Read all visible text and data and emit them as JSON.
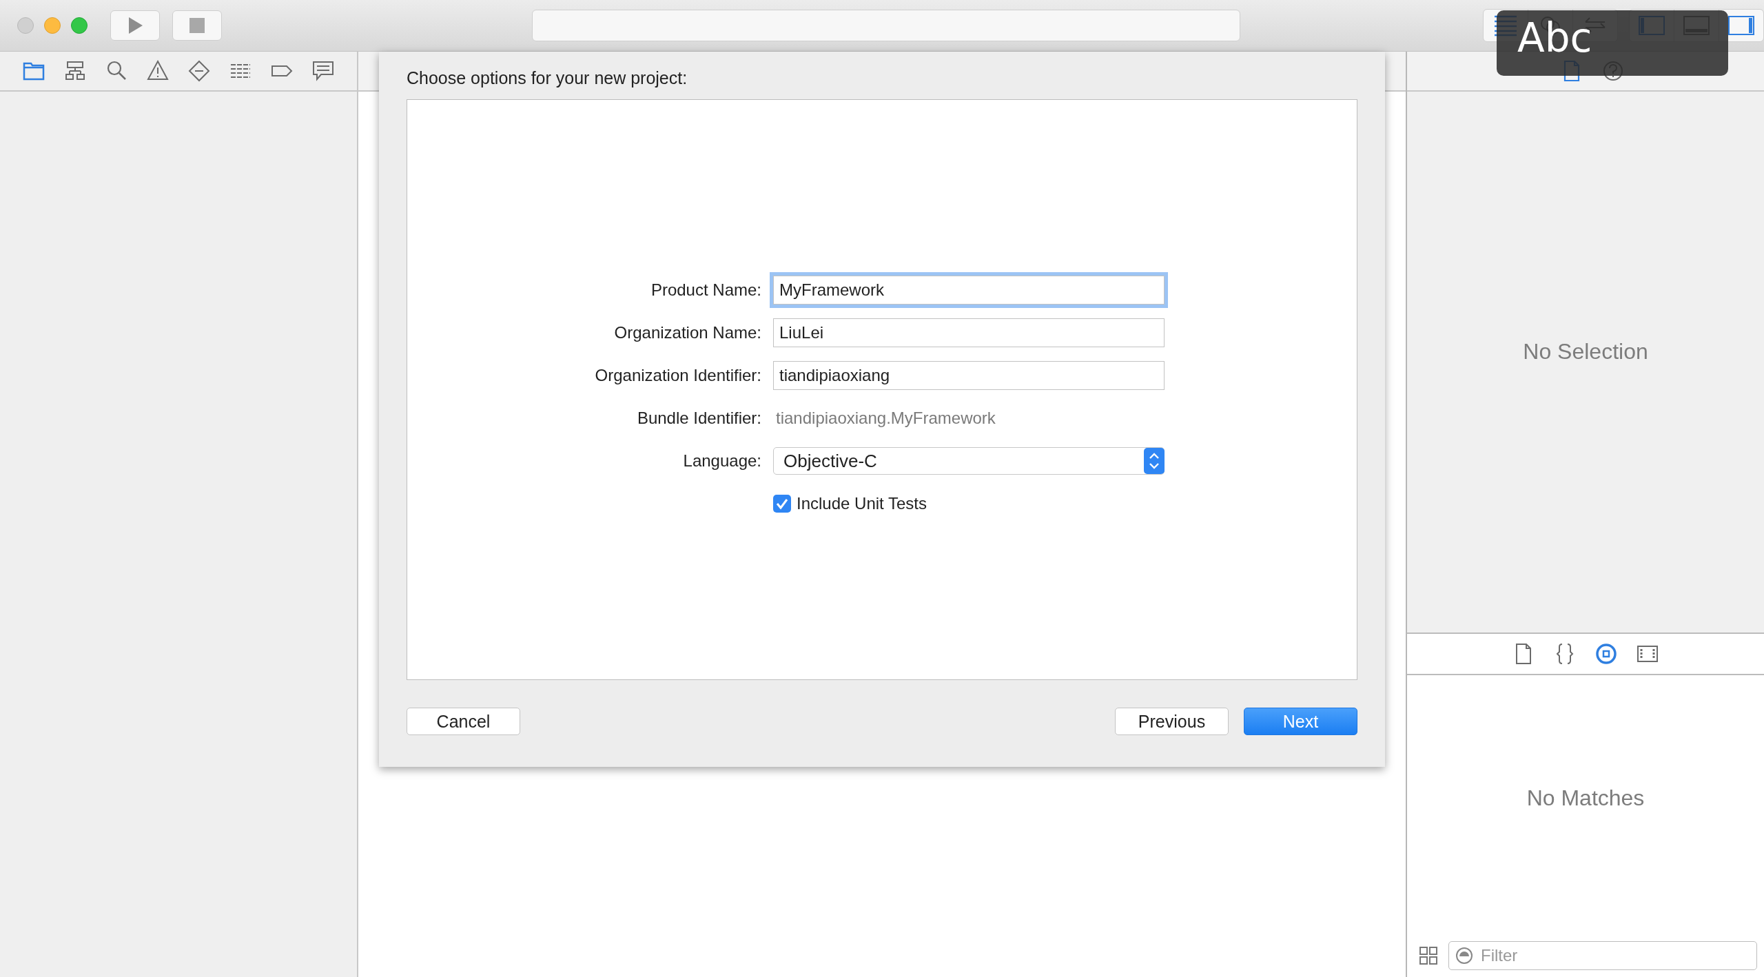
{
  "run_controls": [
    {
      "kind": "run",
      "disabled": false
    },
    {
      "kind": "stop",
      "disabled": true
    }
  ],
  "editor_modes": [
    {
      "kind": "standard",
      "selected": true
    },
    {
      "kind": "assistant",
      "selected": false
    },
    {
      "kind": "version",
      "selected": false
    }
  ],
  "panel_toggles": [
    {
      "kind": "navigator",
      "on": true
    },
    {
      "kind": "debug",
      "on": false
    },
    {
      "kind": "utilities",
      "on": true
    }
  ],
  "navigator_tabs": [
    {
      "kind": "folder",
      "selected": true
    },
    {
      "kind": "hierarchy",
      "selected": false
    },
    {
      "kind": "search",
      "selected": false
    },
    {
      "kind": "warning",
      "selected": false
    },
    {
      "kind": "breakpoint",
      "selected": false
    },
    {
      "kind": "list",
      "selected": false
    },
    {
      "kind": "tag",
      "selected": false
    },
    {
      "kind": "message",
      "selected": false
    }
  ],
  "sheet": {
    "title": "Choose options for your new project:",
    "fields": [
      {
        "kind": "text",
        "label": "Product Name:",
        "value": "MyFramework",
        "focused": true
      },
      {
        "kind": "text",
        "label": "Organization Name:",
        "value": "LiuLei",
        "focused": false
      },
      {
        "kind": "text",
        "label": "Organization Identifier:",
        "value": "tiandipiaoxiang",
        "focused": false
      },
      {
        "kind": "static",
        "label": "Bundle Identifier:",
        "value": "tiandipiaoxiang.MyFramework"
      },
      {
        "kind": "popup",
        "label": "Language:",
        "value": "Objective-C"
      }
    ],
    "checkbox": {
      "label": "Include Unit Tests",
      "checked": true
    },
    "buttons": [
      {
        "label": "Cancel",
        "kind": "secondary"
      },
      {
        "label": "Previous",
        "kind": "secondary"
      },
      {
        "label": "Next",
        "kind": "primary"
      }
    ]
  },
  "inspector": {
    "tabs": [
      {
        "kind": "file",
        "selected": true
      },
      {
        "kind": "help",
        "selected": false
      }
    ],
    "empty_text": "No Selection"
  },
  "library": {
    "tabs": [
      {
        "kind": "file",
        "selected": false
      },
      {
        "kind": "braces",
        "selected": false
      },
      {
        "kind": "object",
        "selected": true
      },
      {
        "kind": "media",
        "selected": false
      }
    ],
    "empty_text": "No Matches",
    "filter": {
      "placeholder": "Filter"
    }
  },
  "input_source_hud": {
    "text": "Abc"
  }
}
